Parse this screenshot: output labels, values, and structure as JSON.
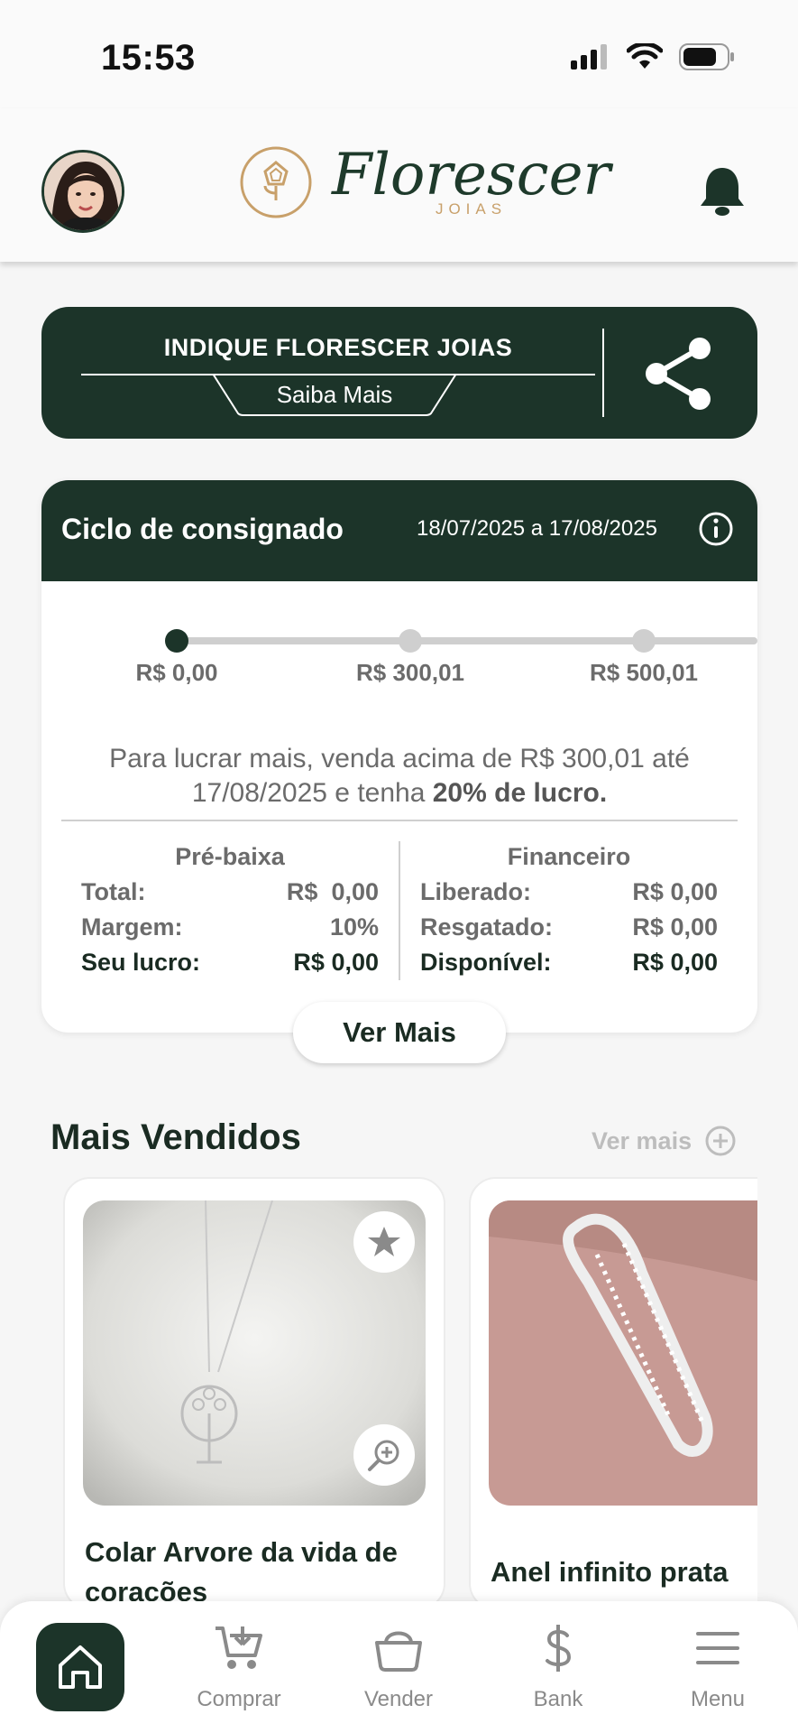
{
  "status": {
    "time": "15:53"
  },
  "header": {
    "brand_name": "Florescer",
    "brand_sub": "JOIAS"
  },
  "referral": {
    "title": "INDIQUE FLORESCER JOIAS",
    "link_label": "Saiba Mais"
  },
  "cycle": {
    "title": "Ciclo de consignado",
    "dates": "18/07/2025 a 17/08/2025",
    "tiers": [
      "R$ 0,00",
      "R$ 300,01",
      "R$ 500,01"
    ],
    "current_tier_index": 0,
    "message_prefix": "Para lucrar mais, venda acima de R$ 300,01 até 17/08/2025 e tenha ",
    "message_highlight": "20% de lucro.",
    "pre_baixa": {
      "heading": "Pré-baixa",
      "rows": [
        {
          "label": "Total:",
          "value": "R$  0,00"
        },
        {
          "label": "Margem:",
          "value": "10%"
        },
        {
          "label": "Seu lucro:",
          "value": "R$ 0,00"
        }
      ]
    },
    "financeiro": {
      "heading": "Financeiro",
      "rows": [
        {
          "label": "Liberado:",
          "value": "R$ 0,00"
        },
        {
          "label": "Resgatado:",
          "value": "R$ 0,00"
        },
        {
          "label": "Disponível:",
          "value": "R$ 0,00"
        }
      ]
    },
    "more_button": "Ver Mais"
  },
  "best_sellers": {
    "title": "Mais Vendidos",
    "more_label": "Ver mais",
    "products": [
      {
        "name": "Colar Arvore da vida de corações"
      },
      {
        "name": "Anel infinito prata"
      }
    ]
  },
  "nav": {
    "items": [
      {
        "label": "Comprar"
      },
      {
        "label": "Vender"
      },
      {
        "label": "Bank"
      },
      {
        "label": "Menu"
      }
    ]
  },
  "colors": {
    "primary": "#1c3429",
    "gold": "#c8a06a",
    "muted": "#6b6b6b"
  }
}
